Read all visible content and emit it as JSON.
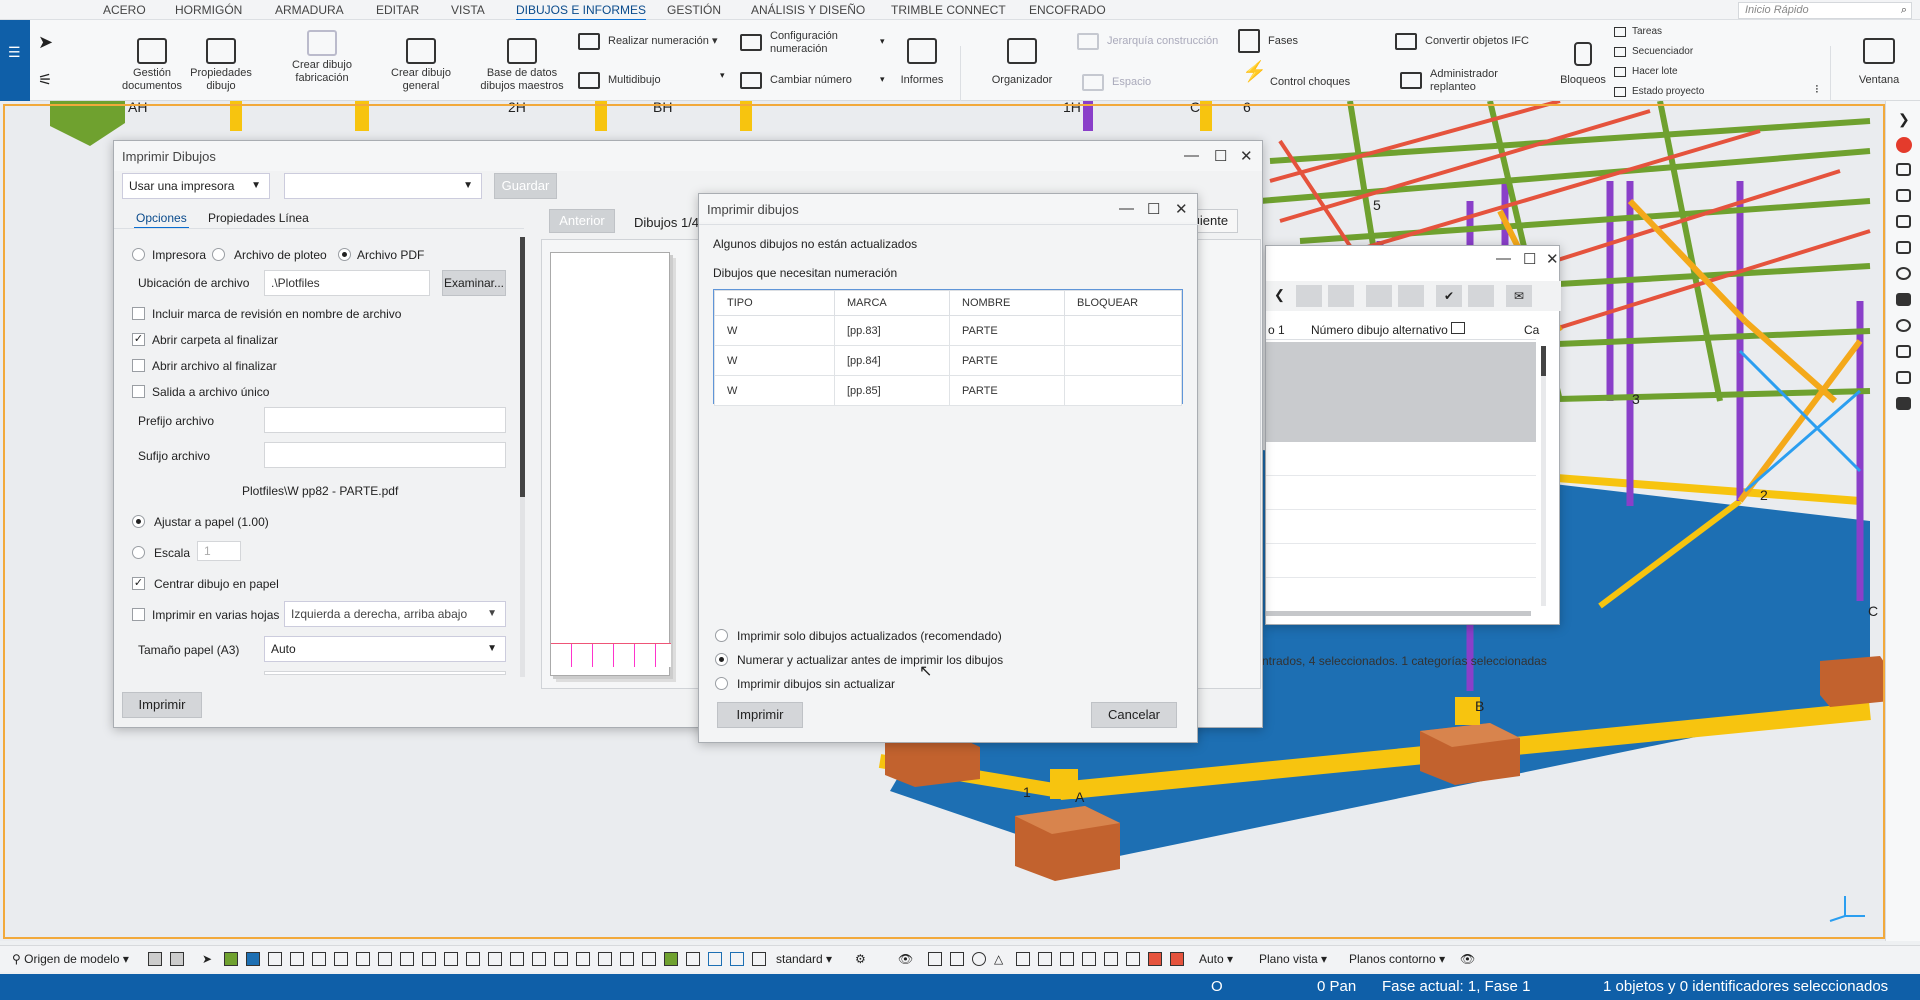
{
  "menu": {
    "tabs": [
      "ACERO",
      "HORMIGÓN",
      "ARMADURA",
      "EDITAR",
      "VISTA",
      "DIBUJOS E INFORMES",
      "GESTIÓN",
      "ANÁLISIS Y DISEÑO",
      "TRIMBLE CONNECT",
      "ENCOFRADO"
    ],
    "active_tab": "DIBUJOS E INFORMES",
    "quick_launch": "Inicio Rápido"
  },
  "ribbon": {
    "gestion": "Gestión documentos",
    "propiedades": "Propiedades dibujo",
    "crear_fab": "Crear dibujo fabricación",
    "crear_general": "Crear dibujo general",
    "base_datos": "Base de datos dibujos maestros",
    "realizar_num": "Realizar numeración",
    "multidibujo": "Multidibujo",
    "config_num": "Configuración numeración",
    "cambiar_num": "Cambiar número",
    "informes": "Informes",
    "organizador": "Organizador",
    "jerarquia": "Jerarquía construcción",
    "espacio": "Espacio",
    "fases": "Fases",
    "control_choques": "Control choques",
    "convertir_ifc": "Convertir objetos IFC",
    "admin_replanteo": "Administrador replanteo",
    "bloqueos": "Bloqueos",
    "tareas": "Tareas",
    "secuenciador": "Secuenciador",
    "hacer_lote": "Hacer lote",
    "estado_proyecto": "Estado proyecto",
    "ventana": "Ventana"
  },
  "grid_labels": [
    "AH",
    "2H",
    "BH",
    "1H",
    "C",
    "6",
    "5",
    "3",
    "2",
    "B",
    "1",
    "A",
    "C"
  ],
  "print_dialog": {
    "title": "Imprimir Dibujos",
    "printer_select": "Usar una impresora",
    "save": "Guardar",
    "tab_options": "Opciones",
    "tab_line": "Propiedades Línea",
    "out_printer": "Impresora",
    "out_plot": "Archivo de ploteo",
    "out_pdf": "Archivo PDF",
    "file_location_label": "Ubicación de archivo",
    "file_location": ".\\Plotfiles",
    "browse": "Examinar...",
    "include_rev": "Incluir marca de revisión en nombre de archivo",
    "open_folder": "Abrir carpeta al finalizar",
    "open_file": "Abrir archivo al finalizar",
    "single_file": "Salida a archivo único",
    "prefix": "Prefijo archivo",
    "suffix": "Sufijo archivo",
    "file_preview": "Plotfiles\\W pp82 - PARTE.pdf",
    "fit_paper": "Ajustar a papel (1.00)",
    "scale": "Escala",
    "scale_value": "1",
    "center": "Centrar dibujo en papel",
    "multi_sheet": "Imprimir en varias hojas",
    "sheet_order": "Izquierda a derecha, arriba abajo",
    "paper_size_label": "Tamaño papel (A3)",
    "paper_size": "Auto",
    "print_btn": "Imprimir",
    "prev": "Anterior",
    "counter": "Dibujos 1/4",
    "next": "Siguiente"
  },
  "doc_manager": {
    "col1": "o 1",
    "col2": "Número dibujo alternativo",
    "col3": "Ca",
    "status": "ntrados, 4 seleccionados. 1 categorías seleccionadas"
  },
  "confirm_dialog": {
    "title": "Imprimir dibujos",
    "msg1": "Algunos dibujos no están actualizados",
    "msg2": "Dibujos que necesitan numeración",
    "columns": [
      "TIPO",
      "MARCA",
      "NOMBRE",
      "BLOQUEAR"
    ],
    "rows": [
      [
        "W",
        "[pp.83]",
        "PARTE",
        ""
      ],
      [
        "W",
        "[pp.84]",
        "PARTE",
        ""
      ],
      [
        "W",
        "[pp.85]",
        "PARTE",
        ""
      ]
    ],
    "opt1": "Imprimir solo dibujos actualizados (recomendado)",
    "opt2": "Numerar y actualizar antes de imprimir los dibujos",
    "opt3": "Imprimir dibujos sin actualizar",
    "print_btn": "Imprimir",
    "cancel_btn": "Cancelar"
  },
  "bottom_toolbar": {
    "origin": "Origen de modelo",
    "standard": "standard",
    "auto": "Auto",
    "plane": "Plano vista",
    "contour": "Planos contorno"
  },
  "status_bar": {
    "o": "O",
    "pan": "0  Pan",
    "phase": "Fase actual: 1, Fase 1",
    "selection": "1 objetos y 0 identificadores seleccionados"
  },
  "colors": {
    "accent": "#0f5fa8",
    "frame": "#f2a93b",
    "floor": "#1d6fb3",
    "beam_yellow": "#f7c40f",
    "purple": "#8a3fc9",
    "green": "#6fa12f",
    "red": "#e5533d",
    "footing": "#c2622e"
  }
}
